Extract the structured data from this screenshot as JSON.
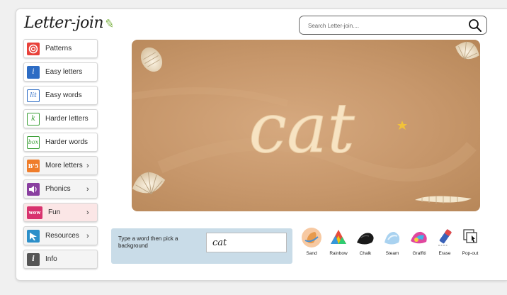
{
  "logo": {
    "text": "Letter-join"
  },
  "search": {
    "placeholder": "Search Letter-join...."
  },
  "sidebar": {
    "items": [
      {
        "label": "Patterns",
        "icon": "spiral-icon",
        "color": "#e8413a",
        "glyph": "@"
      },
      {
        "label": "Easy letters",
        "icon": "letter-i-icon",
        "color": "#2d6cc4",
        "glyph": "i"
      },
      {
        "label": "Easy words",
        "icon": "lit-word-icon",
        "color": "#ffffff",
        "glyph": "lit"
      },
      {
        "label": "Harder letters",
        "icon": "letter-k-icon",
        "color": "#3fa03a",
        "glyph": "k"
      },
      {
        "label": "Harder words",
        "icon": "box-word-icon",
        "color": "#ffffff",
        "glyph": "box"
      },
      {
        "label": "More letters",
        "icon": "b5-icon",
        "color": "#ef7d2b",
        "glyph": "B'5"
      },
      {
        "label": "Phonics",
        "icon": "speaker-icon",
        "color": "#8a3fa0",
        "glyph": "◀)"
      },
      {
        "label": "Fun",
        "icon": "wow-icon",
        "color": "#d8326e",
        "glyph": "wow"
      },
      {
        "label": "Resources",
        "icon": "resources-arrow-icon",
        "color": "#2c8fc9",
        "glyph": "➘"
      },
      {
        "label": "Info",
        "icon": "info-icon",
        "color": "#555555",
        "glyph": "i"
      }
    ]
  },
  "canvas": {
    "word": "cat",
    "background": "sand"
  },
  "word_entry": {
    "prompt": "Type a word then pick a background",
    "value": "cat"
  },
  "tools": [
    {
      "label": "Sand",
      "icon": "sand-icon"
    },
    {
      "label": "Rainbow",
      "icon": "rainbow-icon"
    },
    {
      "label": "Chalk",
      "icon": "chalk-icon"
    },
    {
      "label": "Steam",
      "icon": "steam-icon"
    },
    {
      "label": "Graffiti",
      "icon": "graffiti-icon"
    },
    {
      "label": "Erase",
      "icon": "eraser-icon"
    },
    {
      "label": "Pop-out",
      "icon": "pop-out-icon"
    }
  ],
  "colors": {
    "sand": "#c99a6e",
    "panel": "#c9dce8",
    "fun_bg": "#fbe6e6"
  }
}
